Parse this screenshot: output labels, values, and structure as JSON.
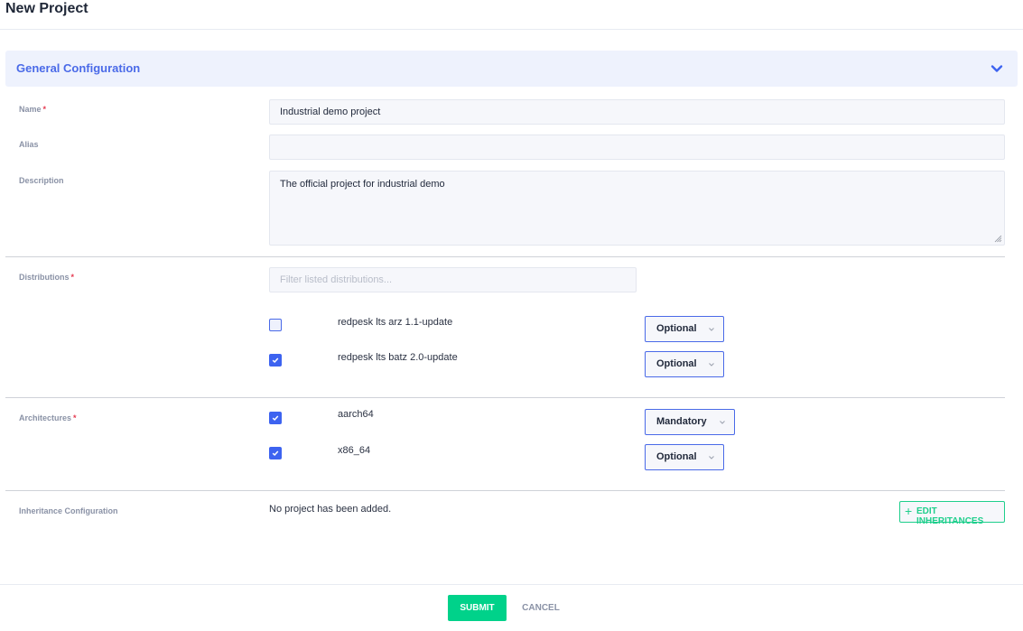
{
  "page": {
    "title": "New Project"
  },
  "section": {
    "title": "General Configuration",
    "chevron_icon": "chevron-down-icon",
    "accent": "#4a6ae8"
  },
  "fields": {
    "name": {
      "label": "Name",
      "required_mark": "*",
      "value": "Industrial demo project"
    },
    "alias": {
      "label": "Alias",
      "value": ""
    },
    "description": {
      "label": "Description",
      "value": "The official project for industrial demo"
    }
  },
  "distributions": {
    "label": "Distributions",
    "required_mark": "*",
    "filter_placeholder": "Filter listed distributions...",
    "items": [
      {
        "name": "redpesk lts arz 1.1-update",
        "checked": false,
        "mode": "Optional"
      },
      {
        "name": "redpesk lts batz 2.0-update",
        "checked": true,
        "mode": "Optional"
      }
    ]
  },
  "architectures": {
    "label": "Architectures",
    "required_mark": "*",
    "items": [
      {
        "name": "aarch64",
        "checked": true,
        "mode": "Mandatory"
      },
      {
        "name": "x86_64",
        "checked": true,
        "mode": "Optional"
      }
    ]
  },
  "inheritance": {
    "label": "Inheritance Configuration",
    "empty_text": "No project has been added.",
    "edit_button": "EDIT INHERITANCES",
    "edit_icon": "plus-icon",
    "button_color": "#1fcf8c"
  },
  "footer": {
    "submit_label": "SUBMIT",
    "cancel_label": "CANCEL",
    "submit_color": "#00d28a"
  }
}
